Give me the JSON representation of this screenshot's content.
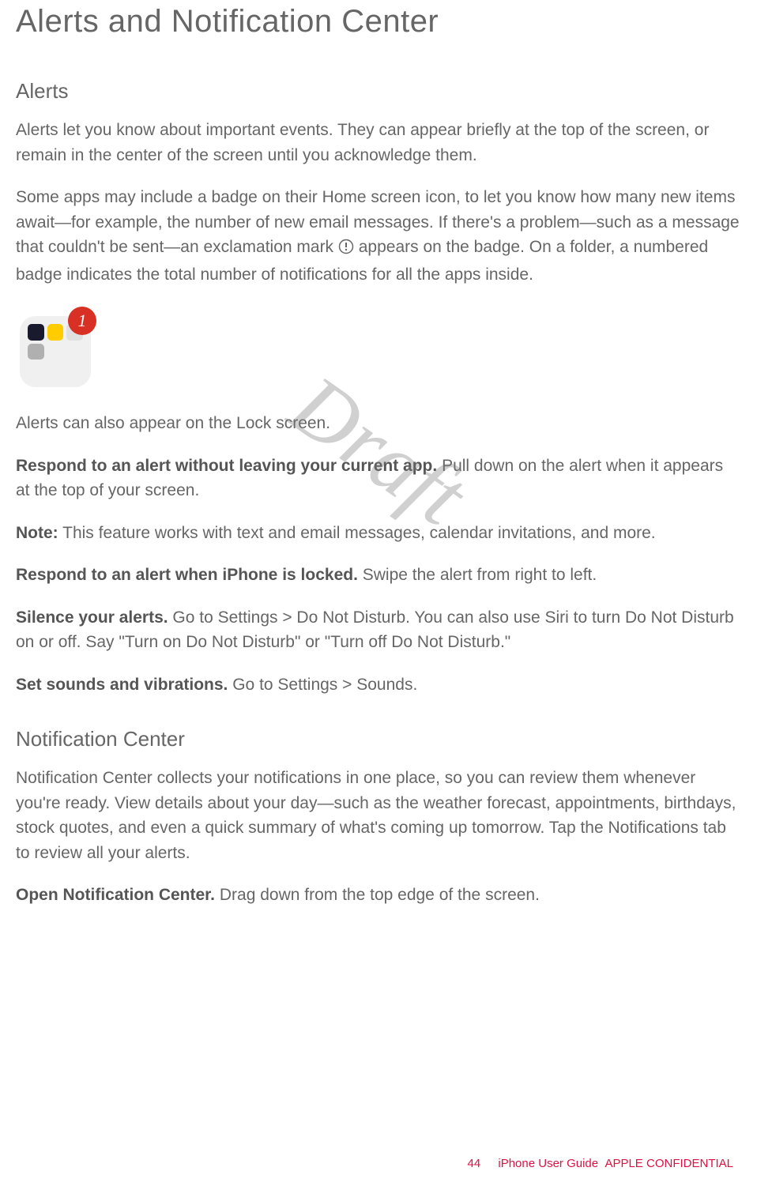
{
  "title": "Alerts and Notification Center",
  "watermark": "Draft",
  "sections": {
    "alerts": {
      "heading": "Alerts",
      "p1": "Alerts let you know about important events. They can appear briefly at the top of the screen, or remain in the center of the screen until you acknowledge them.",
      "p2_a": "Some apps may include a badge on their Home screen icon, to let you know how many new items await—for example, the number of new email messages. If there's a problem—such as a message that couldn't be sent—an exclamation mark ",
      "p2_b": " appears on the badge. On a folder, a numbered badge indicates the total number of notifications for all the apps inside.",
      "badge_number": "1",
      "p3": "Alerts can also appear on the Lock screen.",
      "respond_app_bold": "Respond to an alert without leaving your current app.",
      "respond_app_text": " Pull down on the alert when it appears at the top of your screen.",
      "note_bold": "Note:",
      "note_text": " This feature works with text and email messages, calendar invitations, and more.",
      "respond_locked_bold": "Respond to an alert when iPhone is locked.",
      "respond_locked_text": " Swipe the alert from right to left.",
      "silence_bold": "Silence your alerts.",
      "silence_text": " Go to Settings > Do Not Disturb. You can also use Siri to turn Do Not Disturb on or off. Say \"Turn on Do Not Disturb\" or \"Turn off Do Not Disturb.\"",
      "sounds_bold": "Set sounds and vibrations.",
      "sounds_text": " Go to Settings > Sounds."
    },
    "notification_center": {
      "heading": "Notification Center",
      "p1": "Notification Center collects your notifications in one place, so you can review them whenever you're ready. View details about your day—such as the weather forecast, appointments, birthdays, stock quotes, and even a quick summary of what's coming up tomorrow. Tap the Notifications tab to review all your alerts.",
      "open_bold": "Open Notification Center.",
      "open_text": " Drag down from the top edge of the screen."
    }
  },
  "footer": {
    "page_number": "44",
    "doc_title": "iPhone User Guide",
    "confidential": "APPLE CONFIDENTIAL"
  }
}
